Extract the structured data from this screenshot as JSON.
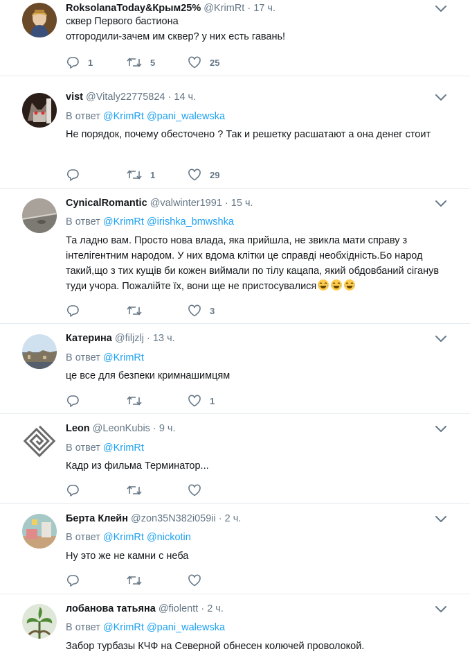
{
  "tweets": [
    {
      "name": "RoksolanaToday&Крым25%",
      "handle": "@KrimRt",
      "time": "17 ч.",
      "in_reply": false,
      "reply_prefix": "",
      "mentions": [],
      "text": "сквер Первого бастиона\nотгородили-зачем им сквер? у  них есть гавань!",
      "replies": "1",
      "retweets": "5",
      "likes": "25",
      "avatar_icon": "portrait-woman-icon"
    },
    {
      "name": "vist",
      "handle": "@Vitaly22775824",
      "time": "14 ч.",
      "in_reply": true,
      "reply_prefix": "В ответ",
      "mentions": [
        "@KrimRt",
        "@pani_walewska"
      ],
      "text": "Не порядок, почему обесточено ? Так и решетку расшатают а она денег стоит",
      "replies": "",
      "retweets": "1",
      "likes": "29",
      "avatar_icon": "cat-face-icon"
    },
    {
      "name": "CynicalRomantic",
      "handle": "@valwinter1991",
      "time": "15 ч.",
      "in_reply": true,
      "reply_prefix": "В ответ",
      "mentions": [
        "@KrimRt",
        "@irishka_bmwshka"
      ],
      "text": "Та ладно вам. Просто нова влада, яка прийшла, не звикла мати справу з інтелігентним народом. У них вдома клітки це справді необхідність.Бо народ такий,що з тих кущів би кожен виймали по тілу кацапа, який обдовбаний сіганув туди учора. Пожалійте їх, вони ще не пристосувалися",
      "replies": "",
      "retweets": "",
      "likes": "3",
      "avatar_icon": "road-photo-icon"
    },
    {
      "name": "Катерина",
      "handle": "@filjzlj",
      "time": "13 ч.",
      "in_reply": true,
      "reply_prefix": "В ответ",
      "mentions": [
        "@KrimRt"
      ],
      "text": "це все для безпеки кримнашимцям",
      "replies": "",
      "retweets": "",
      "likes": "1",
      "avatar_icon": "city-landscape-icon"
    },
    {
      "name": "Leon",
      "handle": "@LeonKubis",
      "time": "9 ч.",
      "in_reply": true,
      "reply_prefix": "В ответ",
      "mentions": [
        "@KrimRt"
      ],
      "text": "Кадр из фильма Терминатор...",
      "replies": "",
      "retweets": "",
      "likes": "",
      "avatar_icon": "spiral-logo-icon"
    },
    {
      "name": "Берта Клейн",
      "handle": "@zon35N382i059ii",
      "time": "2 ч.",
      "in_reply": true,
      "reply_prefix": "В ответ",
      "mentions": [
        "@KrimRt",
        "@nickotin"
      ],
      "text": "Ну это же не камни с неба",
      "replies": "",
      "retweets": "",
      "likes": "",
      "avatar_icon": "room-interior-icon"
    },
    {
      "name": "лобанова татьяна",
      "handle": "@fiolentt",
      "time": "2 ч.",
      "in_reply": true,
      "reply_prefix": "В ответ",
      "mentions": [
        "@KrimRt",
        "@pani_walewska"
      ],
      "text": "Забор турбазы КЧФ на Северной обнесен колючей проволокой.",
      "replies": "",
      "retweets": "",
      "likes": "",
      "avatar_icon": "plant-photo-icon"
    }
  ],
  "icons": {
    "reply": "reply-icon",
    "retweet": "retweet-icon",
    "like": "heart-icon",
    "menu": "chevron-down-icon",
    "emoji": "tears-of-joy-emoji"
  },
  "colors": {
    "link": "#1da1f2",
    "secondary": "#657786",
    "text": "#14171a",
    "divider": "#e6ecf0"
  },
  "separator": "·"
}
